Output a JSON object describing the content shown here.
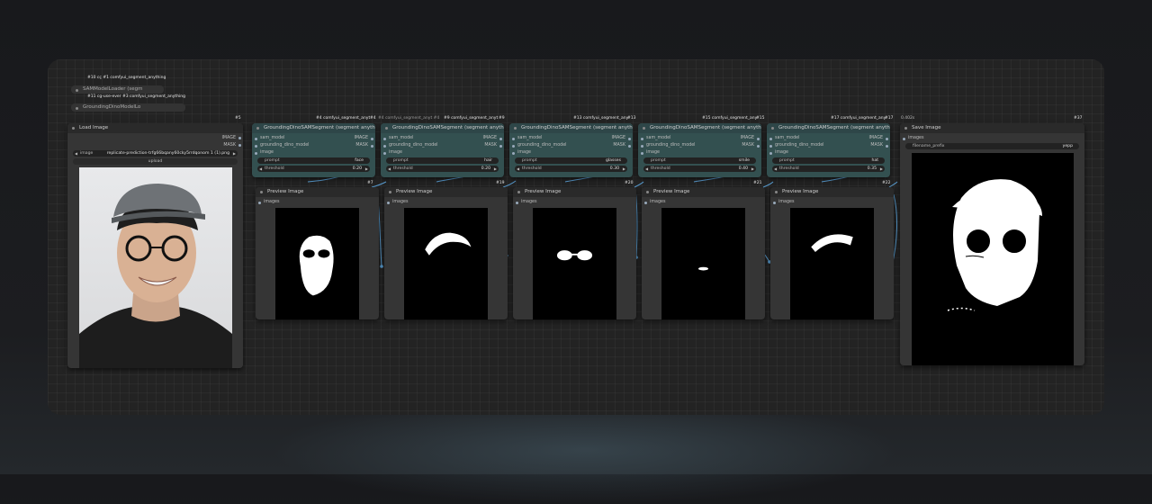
{
  "groups": [
    {
      "x": "#10 cç",
      "y": "#1 comfyui_segment_anything"
    },
    {
      "x": "#11 cg-use-ever",
      "y": "#3 comfyui_segment_anything"
    }
  ],
  "loaders": {
    "sam": "SAMModelLoader (segm",
    "dino": "GroundingDinoModelLo"
  },
  "load_image": {
    "id": "#5",
    "title": "Load Image",
    "out_image": "IMAGE",
    "out_mask": "MASK",
    "widget_label": "image",
    "widget_value": "replicate-prediction-trfg66bqany60cky5rrdqonom 1 (1).png",
    "upload": "upload"
  },
  "seg_nodes": [
    {
      "badge": "#4 comfyui_segment_anyt",
      "id": "#4",
      "title": "GroundingDinoSAMSegment (segment anything)",
      "in1": "sam_model",
      "in2": "grounding_dino_model",
      "in3": "image",
      "out1": "IMAGE",
      "out2": "MASK",
      "prompt_label": "prompt",
      "prompt": "face",
      "threshold_label": "threshold",
      "threshold": "0.20"
    },
    {
      "badge": "#9 comfyui_segment_anyt",
      "id": "#9",
      "pre": "#4 comfyui_segment_anyt #4",
      "title": "GroundingDinoSAMSegment (segment anything)",
      "in1": "sam_model",
      "in2": "grounding_dino_model",
      "in3": "image",
      "out1": "IMAGE",
      "out2": "MASK",
      "prompt_label": "prompt",
      "prompt": "hair",
      "threshold_label": "threshold",
      "threshold": "0.20"
    },
    {
      "badge": "#13 comfyui_segment_any",
      "id": "#13",
      "title": "GroundingDinoSAMSegment (segment anything)",
      "in1": "sam_model",
      "in2": "grounding_dino_model",
      "in3": "image",
      "out1": "IMAGE",
      "out2": "MASK",
      "prompt_label": "prompt",
      "prompt": "glasses",
      "threshold_label": "threshold",
      "threshold": "0.30"
    },
    {
      "badge": "#15 comfyui_segment_any",
      "id": "#15",
      "title": "GroundingDinoSAMSegment (segment anything)",
      "in1": "sam_model",
      "in2": "grounding_dino_model",
      "in3": "image",
      "out1": "IMAGE",
      "out2": "MASK",
      "prompt_label": "prompt",
      "prompt": "smile",
      "threshold_label": "threshold",
      "threshold": "0.40"
    },
    {
      "badge": "#17 comfyui_segment_any",
      "id": "#17",
      "title": "GroundingDinoSAMSegment (segment anything)",
      "in1": "sam_model",
      "in2": "grounding_dino_model",
      "in3": "image",
      "out1": "IMAGE",
      "out2": "MASK",
      "prompt_label": "prompt",
      "prompt": "hat",
      "threshold_label": "threshold",
      "threshold": "0.35"
    }
  ],
  "preview_nodes": [
    {
      "id": "#7",
      "title": "Preview Image",
      "input": "images"
    },
    {
      "id": "#19",
      "title": "Preview Image",
      "input": "images"
    },
    {
      "id": "#20",
      "title": "Preview Image",
      "input": "images"
    },
    {
      "id": "#21",
      "title": "Preview Image",
      "input": "images"
    },
    {
      "id": "#22",
      "title": "Preview Image",
      "input": "images"
    }
  ],
  "save_image": {
    "id": "#37",
    "timer": "0.402s",
    "title": "Save Image",
    "input": "images",
    "widget_label": "filename_prefix",
    "widget_value": "yepp"
  },
  "colors": {
    "link": "#5a9fd4",
    "node": "#353535",
    "seg_node": "#335050"
  }
}
